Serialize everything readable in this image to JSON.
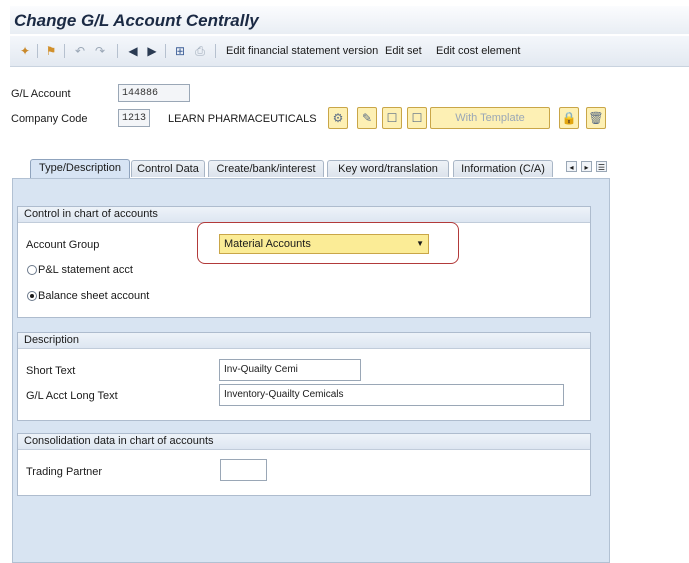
{
  "window": {
    "title": "Change G/L Account Centrally"
  },
  "toolbar": {
    "icons": [
      "new-entry-icon",
      "hierarchy-icon",
      "undo-icon",
      "redo-icon",
      "previous-icon",
      "next-icon",
      "mass-change-icon",
      "print-icon"
    ],
    "actions": {
      "edit_fs_version": "Edit financial statement version",
      "edit_set": "Edit set",
      "edit_cost_element": "Edit cost element"
    }
  },
  "header": {
    "gl_account_label": "G/L Account",
    "gl_account_value": "144886",
    "company_code_label": "Company Code",
    "company_code_value": "1213",
    "company_name": "LEARN PHARMACEUTICALS",
    "with_template_label": "With Template"
  },
  "tabs": [
    {
      "label": "Type/Description",
      "active": true
    },
    {
      "label": "Control Data",
      "active": false
    },
    {
      "label": "Create/bank/interest",
      "active": false
    },
    {
      "label": "Key word/translation",
      "active": false
    },
    {
      "label": "Information (C/A)",
      "active": false
    }
  ],
  "control": {
    "title": "Control in chart of accounts",
    "account_group_label": "Account Group",
    "account_group_value": "Material Accounts",
    "pl_label": "P&L statement acct",
    "bs_label": "Balance sheet account",
    "selected": "Balance sheet account"
  },
  "description": {
    "title": "Description",
    "short_text_label": "Short Text",
    "short_text_value": "Inv-Quailty Cemi",
    "long_text_label": "G/L Acct Long Text",
    "long_text_value": "Inventory-Quailty Cemicals"
  },
  "consolidation": {
    "title": "Consolidation data in chart of accounts",
    "trading_partner_label": "Trading Partner",
    "trading_partner_value": ""
  },
  "colors": {
    "panel": "#d8e4f2",
    "highlight_ring": "#b23a3a",
    "input_active": "#fbec96"
  }
}
